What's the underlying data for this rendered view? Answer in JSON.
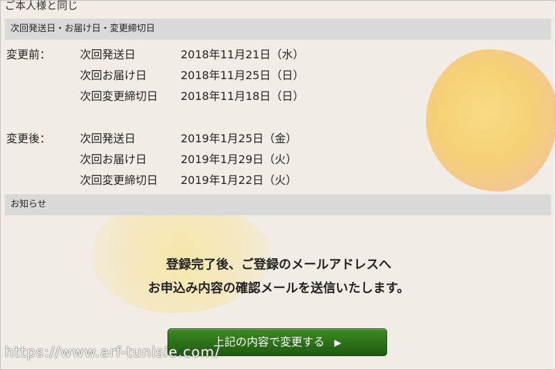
{
  "top_label": "ご本人様と同じ",
  "schedule_section": {
    "title": "次回発送日・お届け日・変更締切日",
    "before": {
      "label": "変更前：",
      "rows": [
        {
          "field": "次回発送日",
          "date": "2018年11月21日（水）"
        },
        {
          "field": "次回お届け日",
          "date": "2018年11月25日（日）"
        },
        {
          "field": "次回変更締切日",
          "date": "2018年11月18日（日）"
        }
      ]
    },
    "after": {
      "label": "変更後：",
      "rows": [
        {
          "field": "次回発送日",
          "date": "2019年1月25日（金）"
        },
        {
          "field": "次回お届け日",
          "date": "2019年1月29日（火）"
        },
        {
          "field": "次回変更締切日",
          "date": "2019年1月22日（火）"
        }
      ]
    }
  },
  "notice_section": {
    "title": "お知らせ",
    "line1": "登録完了後、ご登録のメールアドレスへ",
    "line2": "お申込み内容の確認メールを送信いたします。"
  },
  "submit": {
    "label": "上記の内容で変更する",
    "arrow": "▶"
  },
  "watermark": "https://www.arf-tunisie.com/",
  "colors": {
    "button": "#2e6f1b",
    "section_bar": "#d9d9d9",
    "background": "#f1ede6",
    "blot": "#f6cd68"
  }
}
